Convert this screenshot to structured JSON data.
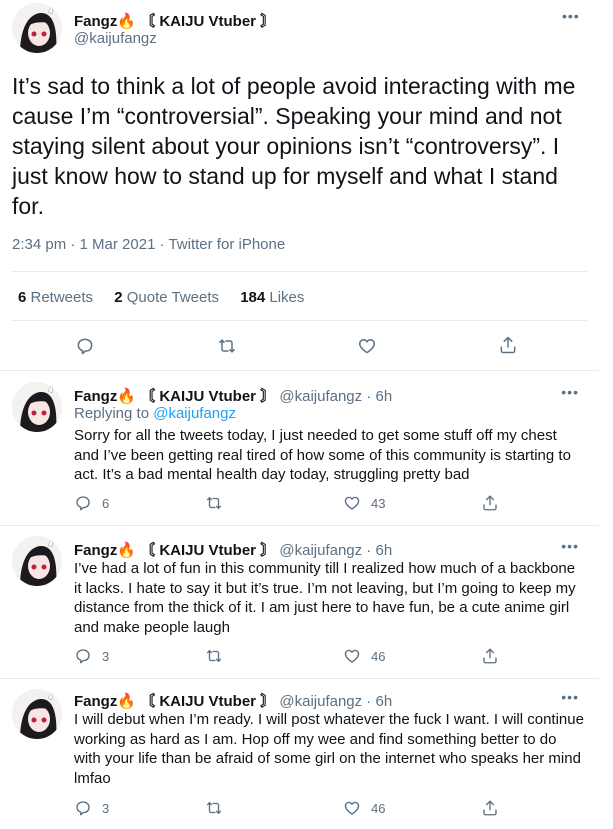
{
  "main": {
    "author_name": "Fangz🔥 〘 KAIJU Vtuber 〙",
    "author_handle": "@kaijufangz",
    "text": "It’s sad to think a lot of people avoid interacting with me cause I’m “controversial”. Speaking your mind and not staying silent about your opinions isn’t “controversy”. I just know how to stand up for myself and what I stand for.",
    "time": "2:34 pm · 1 Mar 2021 · ",
    "source": "Twitter for iPhone",
    "retweets_count": "6",
    "retweets_label": " Retweets",
    "quotes_count": "2",
    "quotes_label": " Quote Tweets",
    "likes_count": "184",
    "likes_label": " Likes",
    "more": "•••"
  },
  "replies": [
    {
      "name": "Fangz🔥 〘 KAIJU Vtuber 〙",
      "handle": " @kaijufangz · 6h",
      "replying_label": "Replying to ",
      "replying_to": "@kaijufangz",
      "text": "Sorry for all the tweets today, I just needed to get some stuff off my chest and I’ve been getting real tired of how some of this community is starting to act. It’s a bad mental health day today, struggling pretty bad",
      "reply_count": "6",
      "like_count": "43",
      "more": "•••"
    },
    {
      "name": "Fangz🔥 〘 KAIJU Vtuber 〙",
      "handle": " @kaijufangz · 6h",
      "text": "I’ve had a lot of fun in this community till I realized how much of a backbone it lacks. I hate to say it but it’s true. I’m not leaving, but I’m going to keep my distance from the thick of it. I am just here to have fun, be a cute anime girl and make people laugh",
      "reply_count": "3",
      "like_count": "46",
      "more": "•••"
    },
    {
      "name": "Fangz🔥 〘 KAIJU Vtuber 〙",
      "handle": " @kaijufangz · 6h",
      "text": "I will debut when I’m ready. I will post whatever the fuck I want. I will continue working as hard as I am. Hop off my wee and find something better to do with your life than be afraid of some girl on the internet who speaks her mind lmfao",
      "reply_count": "3",
      "like_count": "46",
      "more": "•••"
    }
  ],
  "icons": {
    "reply": "reply-icon",
    "retweet": "retweet-icon",
    "like": "heart-icon",
    "share": "share-icon",
    "more": "more-icon"
  },
  "colors": {
    "text": "#0f1419",
    "secondary": "#5b7083",
    "link": "#1da1f2",
    "divider": "#e6ecf0"
  }
}
